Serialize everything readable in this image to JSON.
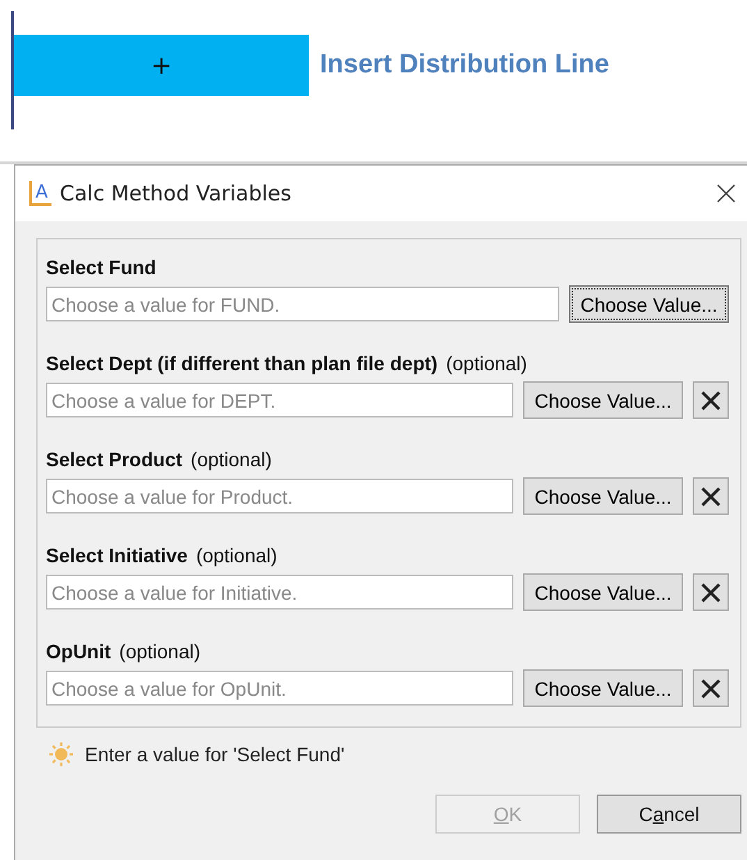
{
  "toolbar": {
    "add_button": {
      "label": "+"
    },
    "link": "Insert Distribution Line"
  },
  "dialog": {
    "title": "Calc Method Variables",
    "app_icon_letter": "A",
    "fields": [
      {
        "label": "Select Fund",
        "placeholder": "Choose a value for FUND.",
        "button": "Choose Value...",
        "button_focused": true,
        "kind": "required"
      },
      {
        "label": "Select Dept (if different than plan file dept)",
        "note": "(optional)",
        "placeholder": "Choose a value for DEPT.",
        "button": "Choose Value...",
        "button_focused": false,
        "kind": "clearable"
      },
      {
        "label": "Select Product",
        "note": "(optional)",
        "placeholder": "Choose a value for Product.",
        "button": "Choose Value...",
        "button_focused": false,
        "kind": "clearable"
      },
      {
        "label": "Select Initiative",
        "note": "(optional)",
        "placeholder": "Choose a value for Initiative.",
        "button": "Choose Value...",
        "button_focused": false,
        "kind": "clearable"
      },
      {
        "label": "OpUnit",
        "note": "(optional)",
        "placeholder": "Choose a value for OpUnit.",
        "button": "Choose Value...",
        "button_focused": false,
        "kind": "clearable"
      }
    ],
    "message": "Enter a value for 'Select Fund'",
    "buttons": [
      {
        "access_key": "O",
        "label_after_key": "K",
        "disabled": true
      },
      {
        "label_before_key": "C",
        "access_key": "a",
        "label_after_key": "ncel",
        "disabled": false
      }
    ]
  }
}
